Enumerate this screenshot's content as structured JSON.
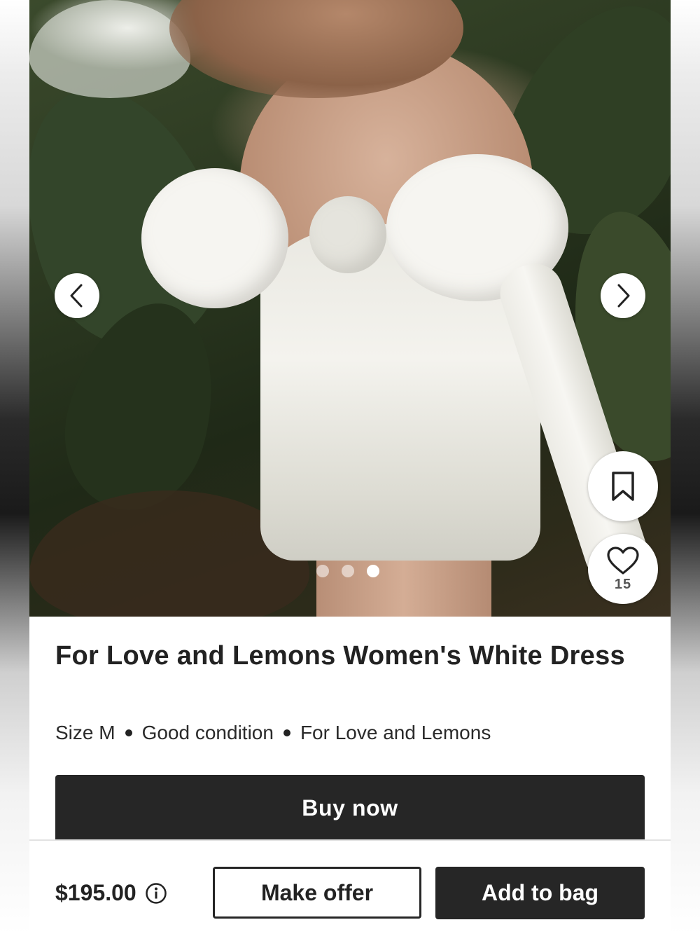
{
  "listing": {
    "title": "For Love and Lemons Women's White Dress",
    "meta": {
      "size": "Size M",
      "condition": "Good condition",
      "brand": "For Love and Lemons"
    },
    "likes": "15",
    "price": "$195.00"
  },
  "gallery": {
    "total_images": 3,
    "active_index": 3,
    "icons": {
      "prev": "chevron-left-icon",
      "next": "chevron-right-icon",
      "save": "bookmark-icon",
      "like": "heart-icon"
    }
  },
  "actions": {
    "buy_now": "Buy now",
    "make_offer": "Make offer",
    "add_to_bag": "Add to bag"
  },
  "colors": {
    "primary_button": "#262626",
    "text": "#222222",
    "background": "#ffffff"
  }
}
